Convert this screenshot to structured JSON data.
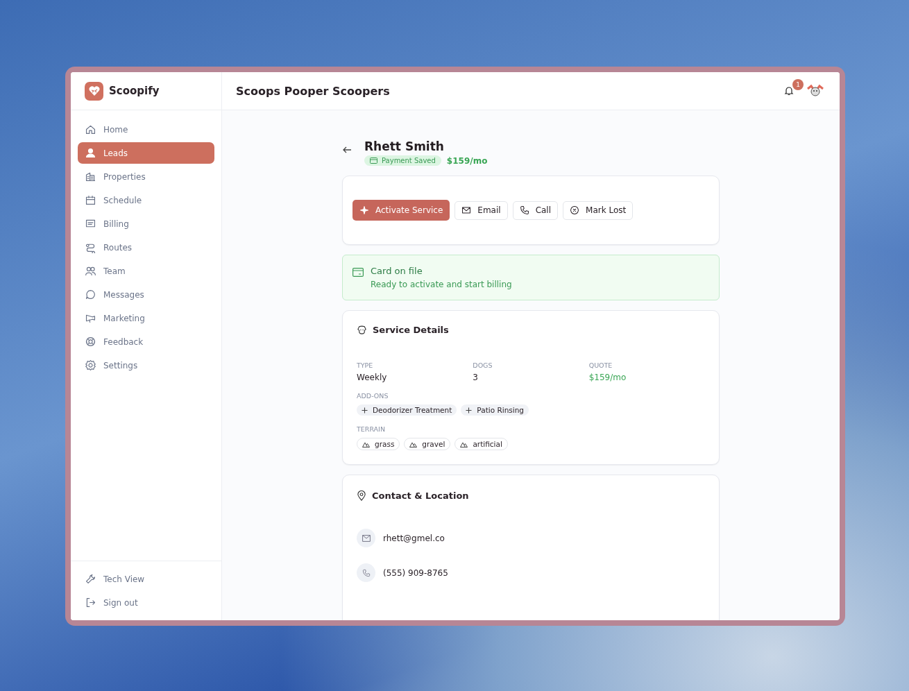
{
  "brand": {
    "name": "Scoopify"
  },
  "header": {
    "title": "Scoops Pooper Scoopers",
    "notification_count": "1"
  },
  "sidebar": {
    "items": [
      {
        "label": "Home",
        "selected": false
      },
      {
        "label": "Leads",
        "selected": true
      },
      {
        "label": "Properties",
        "selected": false
      },
      {
        "label": "Schedule",
        "selected": false
      },
      {
        "label": "Billing",
        "selected": false
      },
      {
        "label": "Routes",
        "selected": false
      },
      {
        "label": "Team",
        "selected": false
      },
      {
        "label": "Messages",
        "selected": false
      },
      {
        "label": "Marketing",
        "selected": false
      },
      {
        "label": "Feedback",
        "selected": false
      },
      {
        "label": "Settings",
        "selected": false
      }
    ],
    "footer_items": [
      {
        "label": "Tech View"
      },
      {
        "label": "Sign out"
      }
    ]
  },
  "lead": {
    "name": "Rhett Smith",
    "badge": "Payment Saved",
    "price": "$159/mo"
  },
  "actions": [
    {
      "label": "Activate Service",
      "kind": "primary"
    },
    {
      "label": "Email",
      "kind": "secondary"
    },
    {
      "label": "Call",
      "kind": "secondary"
    },
    {
      "label": "Mark Lost",
      "kind": "secondary"
    }
  ],
  "card_notice": {
    "title": "Card on file",
    "text": "Ready to activate and start billing"
  },
  "service_details": {
    "title": "Service Details",
    "fields": [
      {
        "label": "TYPE",
        "value": "Weekly",
        "kind": "plain"
      },
      {
        "label": "DOGS",
        "value": "3",
        "kind": "plain"
      },
      {
        "label": "QUOTE",
        "value": "$159/mo",
        "kind": "price"
      }
    ],
    "addons_label": "ADD-ONS",
    "addons": [
      "Deodorizer Treatment",
      "Patio Rinsing"
    ],
    "terrain_label": "TERRAIN",
    "terrain": [
      "grass",
      "gravel",
      "artificial"
    ]
  },
  "contact": {
    "title": "Contact & Location",
    "email": "rhett@gmel.co",
    "phone": "(555) 909-8765"
  }
}
